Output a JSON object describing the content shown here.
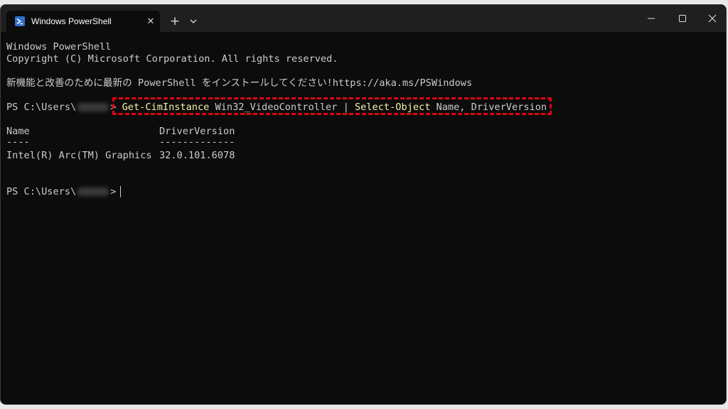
{
  "tab": {
    "title": "Windows PowerShell",
    "icon": "powershell-icon",
    "close_label": "✕"
  },
  "titlebar": {
    "new_tab_label": "+",
    "dropdown_icon": "chevron-down-icon",
    "minimize_icon": "minimize-icon",
    "maximize_icon": "maximize-icon",
    "close_icon": "close-icon"
  },
  "terminal": {
    "banner_line1": "Windows PowerShell",
    "banner_line2": "Copyright (C) Microsoft Corporation. All rights reserved.",
    "banner_line3": "新機能と改善のために最新の PowerShell をインストールしてください!https://aka.ms/PSWindows",
    "prompt_prefix": "PS C:\\Users\\",
    "prompt_suffix": ">",
    "command": {
      "cmdlet1": "Get-CimInstance",
      "arg1": " Win32_VideoController ",
      "pipe": "|",
      "cmdlet2": " Select-Object",
      "arg2": " Name, DriverVersion"
    },
    "output": {
      "header_name": "Name",
      "header_driver": "DriverVersion",
      "sep_name": "----",
      "sep_driver": "-------------",
      "row_name": "Intel(R) Arc(TM) Graphics",
      "row_driver": "32.0.101.6078"
    }
  },
  "colors": {
    "terminal_bg": "#0c0c0c",
    "titlebar_bg": "#1f1f1f",
    "text": "#cccccc",
    "cmdlet": "#f9f1a5",
    "highlight_border": "#e60012"
  }
}
